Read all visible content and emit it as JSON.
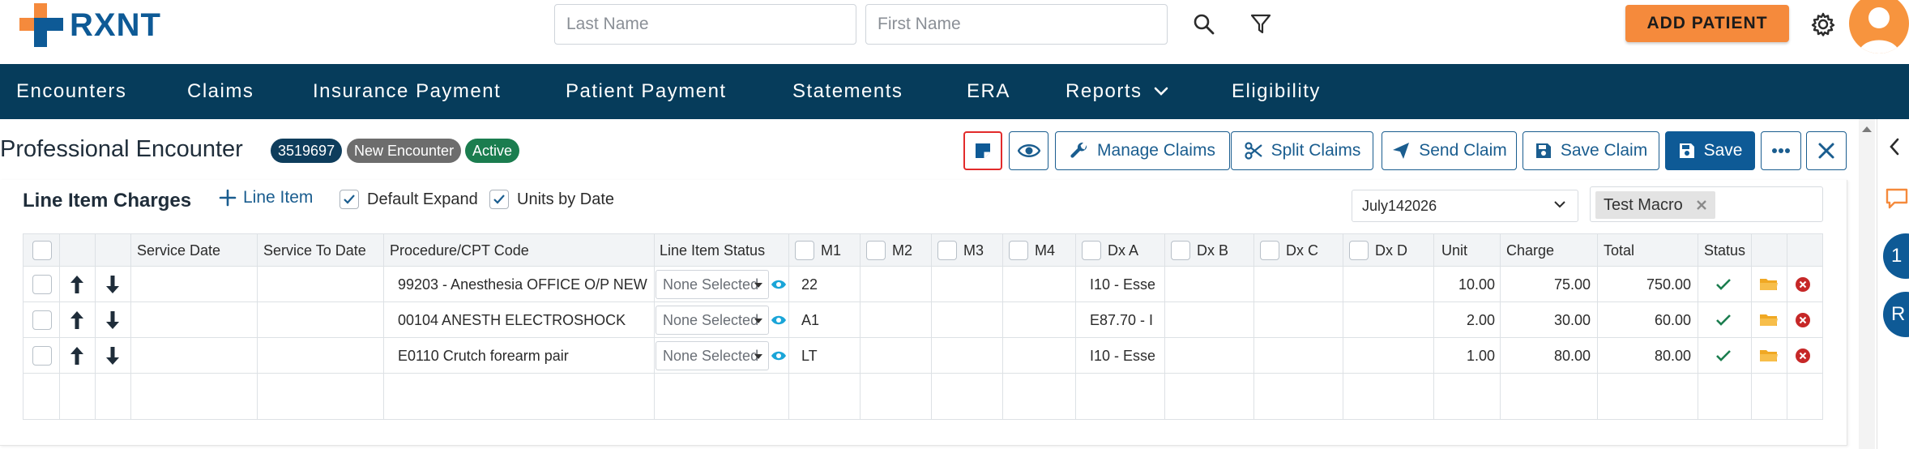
{
  "brand": {
    "logo_text": "RXNT"
  },
  "search": {
    "last_name_placeholder": "Last Name",
    "first_name_placeholder": "First Name"
  },
  "header_actions": {
    "add_patient_label": "ADD PATIENT"
  },
  "nav": {
    "items": [
      {
        "label": "Encounters"
      },
      {
        "label": "Claims"
      },
      {
        "label": "Insurance Payment"
      },
      {
        "label": "Patient Payment"
      },
      {
        "label": "Statements"
      },
      {
        "label": "ERA"
      },
      {
        "label": "Reports"
      },
      {
        "label": "Eligibility"
      }
    ]
  },
  "encounter": {
    "title": "Professional Encounter",
    "id_badge": "3519697",
    "type_badge": "New Encounter",
    "status_badge": "Active"
  },
  "toolbar": {
    "manage_claims": "Manage Claims",
    "split_claims": "Split Claims",
    "send_claim": "Send Claim",
    "save_claim": "Save Claim",
    "save": "Save"
  },
  "side": {
    "badge_1": "1",
    "badge_2": "R"
  },
  "line_items": {
    "title": "Line Item Charges",
    "add_label": "Line Item",
    "default_expand_label": "Default Expand",
    "units_by_date_label": "Units by Date",
    "date_value": "July142026",
    "macro_tag": "Test Macro",
    "columns": {
      "service_date": "Service Date",
      "service_to_date": "Service To Date",
      "procedure": "Procedure/CPT Code",
      "line_item_status": "Line Item Status",
      "m1": "M1",
      "m2": "M2",
      "m3": "M3",
      "m4": "M4",
      "dx_a": "Dx A",
      "dx_b": "Dx B",
      "dx_c": "Dx C",
      "dx_d": "Dx D",
      "unit": "Unit",
      "charge": "Charge",
      "total": "Total",
      "status": "Status"
    },
    "rows": [
      {
        "procedure": "99203 - Anesthesia OFFICE O/P NEW",
        "status": "None Selected",
        "m1": "22",
        "dx_a": "I10 - Esse",
        "unit": "10.00",
        "charge": "75.00",
        "total": "750.00"
      },
      {
        "procedure": "00104 ANESTH ELECTROSHOCK",
        "status": "None Selected",
        "m1": "A1",
        "dx_a": "E87.70 - I",
        "unit": "2.00",
        "charge": "30.00",
        "total": "60.00"
      },
      {
        "procedure": "E0110 Crutch forearm pair",
        "status": "None Selected",
        "m1": "LT",
        "dx_a": "I10 - Esse",
        "unit": "1.00",
        "charge": "80.00",
        "total": "80.00"
      }
    ]
  },
  "colors": {
    "brand_blue": "#0e5a96",
    "brand_orange": "#f58a3c",
    "nav_bg": "#063c5b",
    "badge_id": "#0e3d5c",
    "badge_type": "#6d6d6d",
    "badge_active": "#1b7d4f",
    "note_highlight": "#e22b2b"
  }
}
